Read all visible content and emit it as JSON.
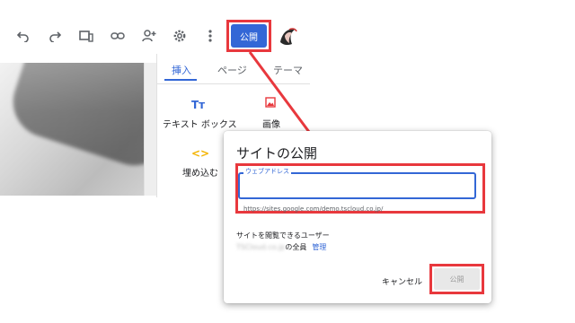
{
  "toolbar": {
    "icons": [
      "undo-icon",
      "redo-icon",
      "preview-devices-icon",
      "link-icon",
      "share-add-person-icon",
      "gear-icon",
      "more-vert-icon"
    ],
    "publish_label": "公開"
  },
  "panel": {
    "tabs": [
      "挿入",
      "ページ",
      "テーマ"
    ],
    "active_tab": "挿入",
    "items": [
      {
        "icon": "Tт",
        "label": "テキスト ボックス"
      },
      {
        "icon": "▣",
        "label": "画像"
      },
      {
        "icon": "<>",
        "label": "埋め込む"
      }
    ]
  },
  "dialog": {
    "title": "サイトの公開",
    "web_address_label": "ウェブアドレス",
    "web_address_value": "",
    "url_hint": "https://sites.google.com/demo.tscloud.co.jp/",
    "viewers_heading": "サイトを閲覧できるユーザー",
    "viewers_domain": "TSCloud.co.jp",
    "viewers_suffix": "の全員",
    "manage_label": "管理",
    "cancel_label": "キャンセル",
    "publish_label": "公開"
  },
  "colors": {
    "accent": "#3367d6",
    "highlight": "#e8383d",
    "text_secondary": "#5f6368"
  }
}
